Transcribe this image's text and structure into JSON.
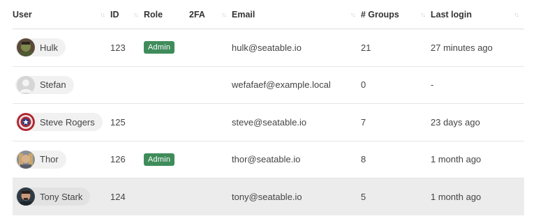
{
  "headers": {
    "user": "User",
    "id": "ID",
    "role": "Role",
    "twofa": "2FA",
    "email": "Email",
    "groups": "# Groups",
    "last_login": "Last login",
    "sort_glyph": "↑↓"
  },
  "users": [
    {
      "name": "Hulk",
      "avatar_icon": "hulk-avatar-icon",
      "id": "123",
      "role": "Admin",
      "twofa": "",
      "email": "hulk@seatable.io",
      "groups": "21",
      "last_login": "27 minutes ago"
    },
    {
      "name": "Stefan",
      "avatar_icon": "default-avatar-icon",
      "id": "",
      "role": "",
      "twofa": "",
      "email": "wefafaef@example.local",
      "groups": "0",
      "last_login": "-"
    },
    {
      "name": "Steve Rogers",
      "avatar_icon": "captain-shield-avatar-icon",
      "id": "125",
      "role": "",
      "twofa": "",
      "email": "steve@seatable.io",
      "groups": "7",
      "last_login": "23 days ago"
    },
    {
      "name": "Thor",
      "avatar_icon": "thor-avatar-icon",
      "id": "126",
      "role": "Admin",
      "twofa": "",
      "email": "thor@seatable.io",
      "groups": "8",
      "last_login": "1 month ago"
    },
    {
      "name": "Tony Stark",
      "avatar_icon": "tony-stark-avatar-icon",
      "id": "124",
      "role": "",
      "twofa": "",
      "email": "tony@seatable.io",
      "groups": "5",
      "last_login": "1 month ago"
    }
  ],
  "colors": {
    "admin_badge": "#3f8c5b",
    "highlight_row": "#ececec"
  }
}
